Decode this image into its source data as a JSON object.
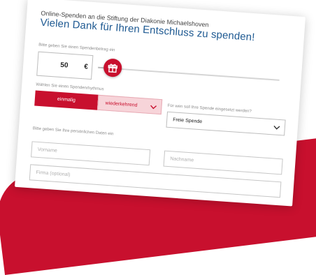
{
  "header": {
    "intro": "Online-Spenden an die Stiftung der Diakonie Michaelshoven",
    "title": "Vielen Dank für Ihren Entschluss zu spenden!"
  },
  "amount": {
    "label": "Bitte geben Sie einen Spendenbetrag ein",
    "value": "50",
    "currency": "€",
    "slider_fraction": 0.08
  },
  "rhythm": {
    "label": "Wählen Sie einen Spendenrhythmus",
    "options": [
      "einmalig",
      "wiederkehrend"
    ],
    "selected": "einmalig"
  },
  "purpose": {
    "label": "Für wen soll Ihre Spende eingesetzt werden?",
    "value": "Freie Spende"
  },
  "personal": {
    "label": "Bitte geben Sie Ihre persönlichen Daten ein",
    "first_name_placeholder": "Vorname",
    "last_name_placeholder": "Nachname",
    "company_placeholder": "Firma (optional)"
  },
  "colors": {
    "brand_red": "#c8102e",
    "heading_blue": "#1f5a92"
  },
  "icons": {
    "slider_thumb": "gift-icon",
    "dropdown": "chevron-down-icon"
  }
}
